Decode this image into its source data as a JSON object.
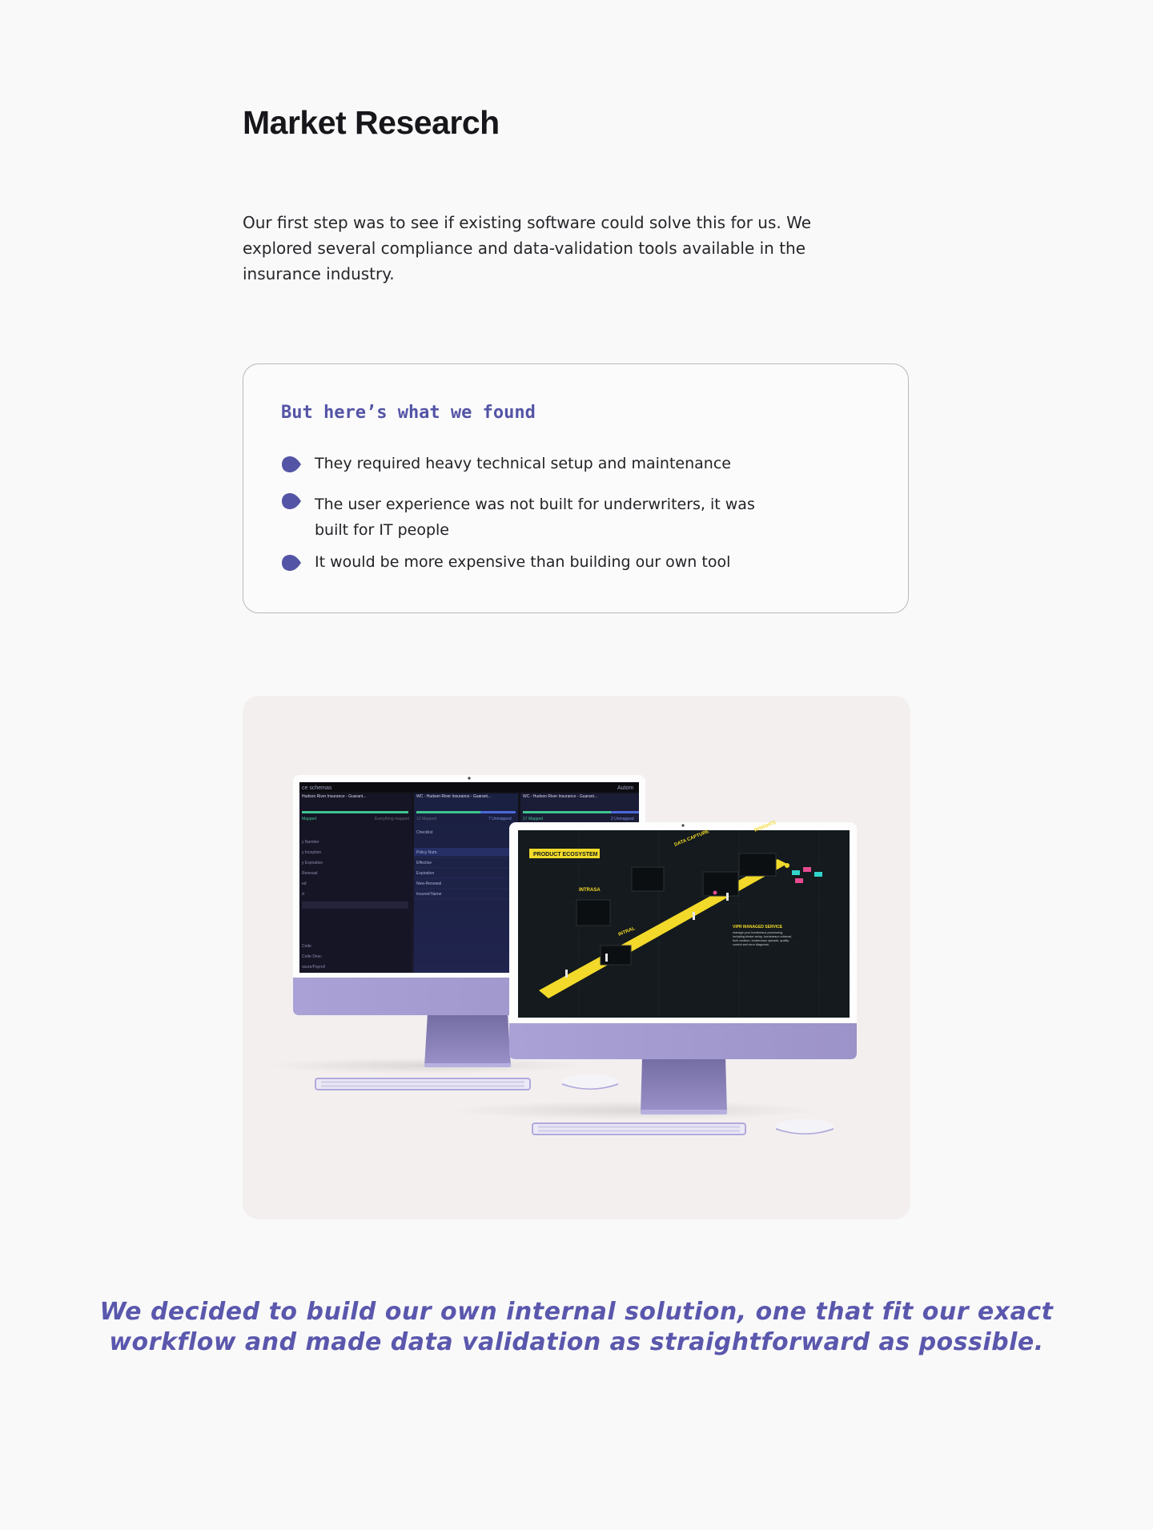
{
  "section": {
    "title": "Market Research",
    "intro": "Our first step was to see if existing software could solve this for us. We explored several compliance and data-validation tools available in the insurance industry."
  },
  "findings": {
    "title": "But here’s what we found",
    "items": [
      "They required heavy technical setup and maintenance",
      "The user experience was not built for underwriters, it was built for IT people",
      "It would be more expensive than building our own tool"
    ]
  },
  "mockup": {
    "back_screen": {
      "header": "ce schemas",
      "header_right": "Autom",
      "tabs": [
        "Hudson River Insurance - Guarant...",
        "WC - Hudson River Insurance - Guarant...",
        "WC - Hudson River Insurance - Guarant..."
      ],
      "stats": [
        "Mapped",
        "Everything mapped",
        "12 Mapped",
        "7 Unmapped",
        "17 Mapped",
        "2 Unmapped"
      ],
      "left_rows": [
        "y Number",
        "y Inception",
        "y Expiration",
        "Renewal",
        "ed",
        "d",
        "",
        "",
        "",
        "Code",
        "Code Desc",
        "ssure/Payroll"
      ],
      "middle_title": "Checklist",
      "middle_rows": [
        "Policy Num.",
        "Effective",
        "Expiration",
        "New-Renewal",
        "Insured Name"
      ]
    },
    "front_screen": {
      "badge": "PRODUCT ECOSYSTEM",
      "stations": [
        "INTRASA",
        "DATA CAPTURE",
        "INTRAL",
        "INSIGHTS",
        "INTRAPAY"
      ],
      "caption_title": "VIPR MANAGED SERVICE",
      "caption_body": "The team to manage your bordereaux processing, including binder setup, bordereaux retrieval, bulk creation, bordereaux uploads, quality control and error diagnosis."
    },
    "colors": {
      "imac_body": "#a89fd1",
      "imac_stand": "#8a83b8",
      "panel_bg": "#f3efef",
      "accent_yellow": "#f2d92a"
    }
  },
  "closing": {
    "text": "We decided to build our own internal solution, one that fit our exact workflow and made data validation as straightforward as possible."
  },
  "colors": {
    "accent": "#5454a6",
    "page_bg": "#f9f9f9"
  }
}
